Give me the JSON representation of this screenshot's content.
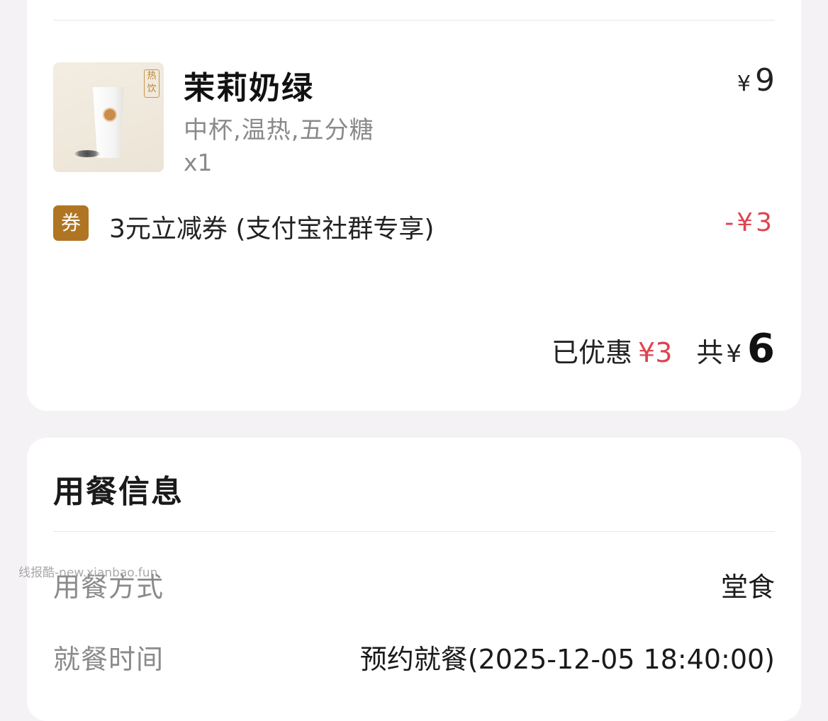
{
  "order": {
    "product": {
      "name": "茉莉奶绿",
      "spec": "中杯,温热,五分糖",
      "qty": "x1",
      "price_symbol": "¥",
      "price": "9",
      "thumb_tag": "热饮"
    },
    "coupon": {
      "badge": "券",
      "label": "3元立减券 (支付宝社群专享)",
      "amount": "-¥3"
    },
    "summary": {
      "discount_label": "已优惠",
      "discount_amount": "¥3",
      "total_label": "共",
      "total_symbol": "¥",
      "total": "6"
    }
  },
  "dining": {
    "title": "用餐信息",
    "rows": [
      {
        "label": "用餐方式",
        "value": "堂食"
      },
      {
        "label": "就餐时间",
        "value": "预约就餐(2025-12-05 18:40:00)"
      }
    ]
  },
  "watermark": "线报酷-new.xianbao.fun",
  "colors": {
    "accent_red": "#e0424f",
    "coupon_badge": "#b07523",
    "background": "#f4f2f5"
  }
}
